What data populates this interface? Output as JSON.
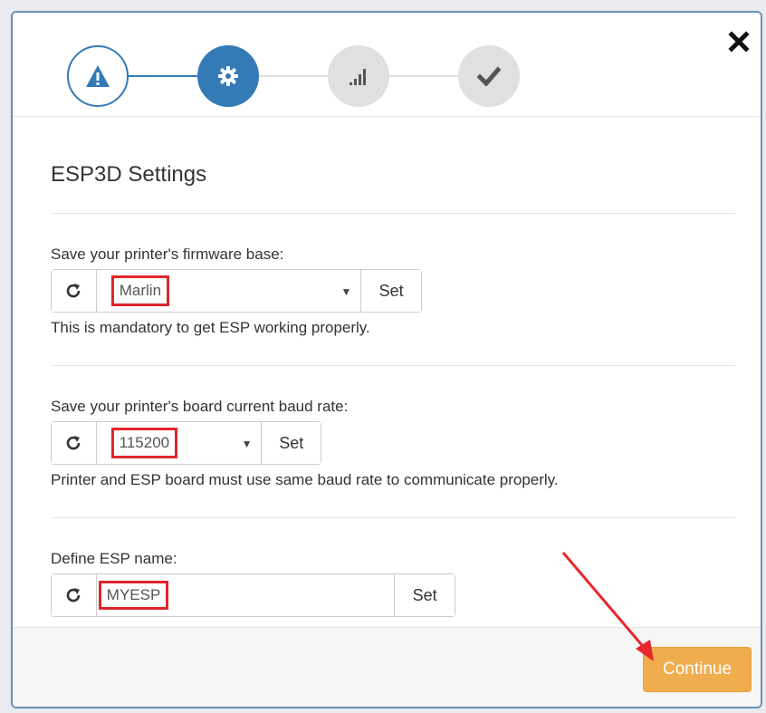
{
  "stepper": {
    "steps": [
      {
        "icon": "warning-icon",
        "state": "done"
      },
      {
        "icon": "gear-icon",
        "state": "active"
      },
      {
        "icon": "signal-icon",
        "state": "todo"
      },
      {
        "icon": "check-icon",
        "state": "todo"
      }
    ]
  },
  "dialog": {
    "title": "ESP3D Settings",
    "close_icon": "close-icon"
  },
  "firmware": {
    "label": "Save your printer's firmware base:",
    "value": "Marlin",
    "set_label": "Set",
    "help": "This is mandatory to get ESP working properly."
  },
  "baud": {
    "label": "Save your printer's board current baud rate:",
    "value": "115200",
    "set_label": "Set",
    "help": "Printer and ESP board must use same baud rate to communicate properly."
  },
  "esp_name": {
    "label": "Define ESP name:",
    "value": "MYESP",
    "set_label": "Set"
  },
  "footer": {
    "continue_label": "Continue"
  },
  "colors": {
    "primary": "#337ab7",
    "warning": "#f0ad4e",
    "highlight": "#e0262b"
  }
}
